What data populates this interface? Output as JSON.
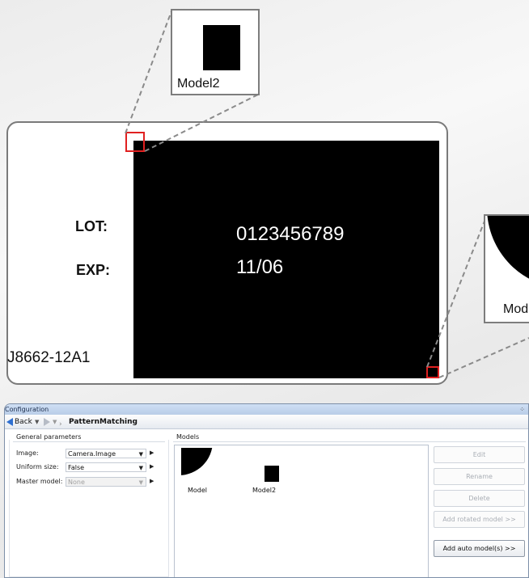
{
  "illustration": {
    "zoom_top_label": "Model2",
    "zoom_right_label": "Mod",
    "lot_label": "LOT:",
    "lot_value": "0123456789",
    "exp_label": "EXP:",
    "exp_value": "11/06",
    "part_code": "J8662-12A1"
  },
  "window": {
    "title": "Configuration",
    "pin_glyph": "⁘",
    "nav": {
      "back_label": "Back",
      "page_title": "PatternMatching"
    },
    "general_parameters": {
      "header": "General parameters",
      "rows": [
        {
          "label": "Image:",
          "value": "Camera.Image",
          "enabled": true
        },
        {
          "label": "Uniform size:",
          "value": "False",
          "enabled": true
        },
        {
          "label": "Master model:",
          "value": "None",
          "enabled": false
        }
      ]
    },
    "models": {
      "header": "Models",
      "items": [
        {
          "name": "Model",
          "shape": "quarter-circle"
        },
        {
          "name": "Model2",
          "shape": "square"
        }
      ]
    },
    "buttons": [
      {
        "label": "Edit",
        "enabled": false
      },
      {
        "label": "Rename",
        "enabled": false
      },
      {
        "label": "Delete",
        "enabled": false
      },
      {
        "label": "Add rotated model >>",
        "enabled": false
      },
      {
        "label": "Add auto model(s) >>",
        "enabled": true
      }
    ]
  },
  "colors": {
    "highlight_red": "#e02020",
    "window_border": "#7d8fa8",
    "titlebar": "#b9cde8",
    "nav_arrow_blue": "#2f6fd0"
  }
}
